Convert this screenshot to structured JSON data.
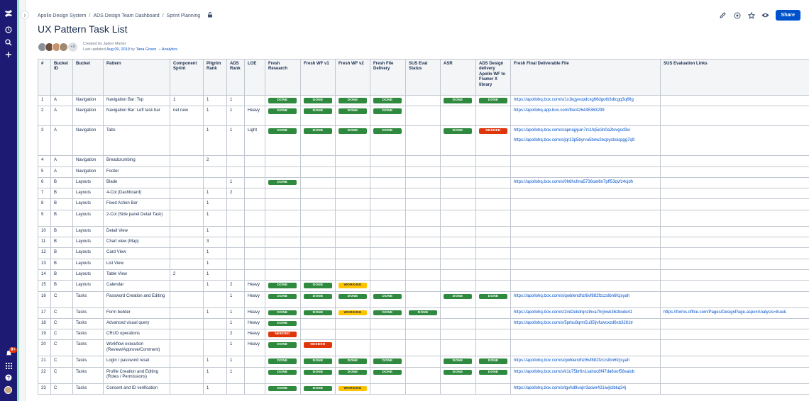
{
  "breadcrumbs": [
    "Apollo Design System",
    "ADS Design Team Dashboard",
    "Sprint Planning"
  ],
  "page_title": "UX Pattern Task List",
  "byline": {
    "created": "Created by Jaden Maher",
    "updated_prefix": "Last updated",
    "updated_date": "Aug 09, 2019",
    "by": "by",
    "author": "Tana Green",
    "analytics": "Analytics",
    "more_count": "+3"
  },
  "share_label": "Share",
  "columns": [
    "#",
    "Bucket ID",
    "Bucket",
    "Pattern",
    "Component Sprint",
    "Pilgrim Rank",
    "ADS Rank",
    "LOE",
    "Fresh Research",
    "Fresh WF v1",
    "Fresh WF v2",
    "Fresh File Delivery",
    "SUS Eval Status",
    "ASR",
    "ADS Design delivery Apollo WF to Framer X library",
    "Fresh Final Deliverable File",
    "SUS Evaluation Links"
  ],
  "rows": [
    {
      "n": "1",
      "bid": "A",
      "bucket": "Navigation",
      "pattern": "Navigation Bar: Top",
      "sprint": "1",
      "pilgrim": "1",
      "ads": "1",
      "loe": "",
      "research": "DONE",
      "wf1": "DONE",
      "wf2": "DONE",
      "file": "DONE",
      "sus": "",
      "asr": "DONE",
      "ads_delivery": "DONE",
      "links": [
        "https://apollohq.box.com/s/1x1kgyvupdcxg66dgotb3dtcgq3q6flg"
      ],
      "sus_links": ""
    },
    {
      "n": "2",
      "bid": "A",
      "bucket": "Navigation",
      "pattern": "Navigation Bar: Left task bar",
      "sprint": "net new",
      "pilgrim": "1",
      "ads": "1",
      "loe": "Heavy",
      "research": "DONE",
      "wf1": "DONE",
      "wf2": "DONE",
      "file": "DONE",
      "sus": "",
      "asr": "",
      "ads_delivery": "",
      "links": [
        "https://apollohq.app.box.com/file/426445363299"
      ],
      "sus_links": ""
    },
    {
      "n": "3",
      "bid": "A",
      "bucket": "Navigation",
      "pattern": "Tabs",
      "sprint": "",
      "pilgrim": "1",
      "ads": "1",
      "loe": "Light",
      "research": "DONE",
      "wf1": "DONE",
      "wf2": "DONE",
      "file": "DONE",
      "sus": "",
      "asr": "DONE",
      "ads_delivery": "NEEDED",
      "links": [
        "https://apollohq.box.com/s/apnajyjuin7rs1fq5e3n0a2tovgsd3vi",
        "https://apollohq.box.com/s/jqr13p5byrvu5bnw2ecpycbsispgg7q9"
      ],
      "sus_links": ""
    },
    {
      "n": "4",
      "bid": "A",
      "bucket": "Navigation",
      "pattern": "Breadcrumbing",
      "sprint": "",
      "pilgrim": "2",
      "ads": "",
      "loe": "",
      "research": "",
      "wf1": "",
      "wf2": "",
      "file": "",
      "sus": "",
      "asr": "",
      "ads_delivery": "",
      "links": [],
      "sus_links": ""
    },
    {
      "n": "5",
      "bid": "A",
      "bucket": "Navigation",
      "pattern": "Footer",
      "sprint": "",
      "pilgrim": "",
      "ads": "",
      "loe": "",
      "research": "",
      "wf1": "",
      "wf2": "",
      "file": "",
      "sus": "",
      "asr": "",
      "ads_delivery": "",
      "links": [],
      "sus_links": ""
    },
    {
      "n": "6",
      "bid": "B",
      "bucket": "Layouts",
      "pattern": "Blade",
      "sprint": "",
      "pilgrim": "",
      "ads": "1",
      "loe": "",
      "research": "DONE",
      "wf1": "",
      "wf2": "",
      "file": "",
      "sus": "",
      "asr": "",
      "ads_delivery": "",
      "links": [
        "https://apollohq.box.com/s/0h6hcfma5736oet6n7pff53qvfz4cjdh"
      ],
      "sus_links": ""
    },
    {
      "n": "7",
      "bid": "B",
      "bucket": "Layouts",
      "pattern": "4-Col (Dashboard)",
      "sprint": "",
      "pilgrim": "1",
      "ads": "2",
      "loe": "",
      "research": "",
      "wf1": "",
      "wf2": "",
      "file": "",
      "sus": "",
      "asr": "",
      "ads_delivery": "",
      "links": [],
      "sus_links": ""
    },
    {
      "n": "8",
      "bid": "B",
      "bucket": "Layouts",
      "pattern": "Fixed Action Bar",
      "sprint": "",
      "pilgrim": "1",
      "ads": "",
      "loe": "",
      "research": "",
      "wf1": "",
      "wf2": "",
      "file": "",
      "sus": "",
      "asr": "",
      "ads_delivery": "",
      "links": [],
      "sus_links": ""
    },
    {
      "n": "9",
      "bid": "B",
      "bucket": "Layouts",
      "pattern": "2-Col (Side panel Detail Task)",
      "sprint": "",
      "pilgrim": "1",
      "ads": "",
      "loe": "",
      "research": "",
      "wf1": "",
      "wf2": "",
      "file": "",
      "sus": "",
      "asr": "",
      "ads_delivery": "",
      "links": [],
      "sus_links": ""
    },
    {
      "n": "10",
      "bid": "B",
      "bucket": "Layouts",
      "pattern": "Detail View",
      "sprint": "",
      "pilgrim": "1",
      "ads": "",
      "loe": "",
      "research": "",
      "wf1": "",
      "wf2": "",
      "file": "",
      "sus": "",
      "asr": "",
      "ads_delivery": "",
      "links": [],
      "sus_links": ""
    },
    {
      "n": "11",
      "bid": "B",
      "bucket": "Layouts",
      "pattern": "Chart view (Map)",
      "sprint": "",
      "pilgrim": "3",
      "ads": "",
      "loe": "",
      "research": "",
      "wf1": "",
      "wf2": "",
      "file": "",
      "sus": "",
      "asr": "",
      "ads_delivery": "",
      "links": [],
      "sus_links": ""
    },
    {
      "n": "12",
      "bid": "B",
      "bucket": "Layouts",
      "pattern": "Card View",
      "sprint": "",
      "pilgrim": "1",
      "ads": "",
      "loe": "",
      "research": "",
      "wf1": "",
      "wf2": "",
      "file": "",
      "sus": "",
      "asr": "",
      "ads_delivery": "",
      "links": [],
      "sus_links": ""
    },
    {
      "n": "13",
      "bid": "B",
      "bucket": "Layouts",
      "pattern": "List View",
      "sprint": "",
      "pilgrim": "1",
      "ads": "",
      "loe": "",
      "research": "",
      "wf1": "",
      "wf2": "",
      "file": "",
      "sus": "",
      "asr": "",
      "ads_delivery": "",
      "links": [],
      "sus_links": ""
    },
    {
      "n": "14",
      "bid": "B",
      "bucket": "Layouts",
      "pattern": "Table View",
      "sprint": "2",
      "pilgrim": "1",
      "ads": "",
      "loe": "",
      "research": "",
      "wf1": "",
      "wf2": "",
      "file": "",
      "sus": "",
      "asr": "",
      "ads_delivery": "",
      "links": [],
      "sus_links": ""
    },
    {
      "n": "15",
      "bid": "B",
      "bucket": "Layouts",
      "pattern": "Calendar",
      "sprint": "",
      "pilgrim": "1",
      "ads": "2",
      "loe": "Heavy",
      "research": "DONE",
      "wf1": "DONE",
      "wf2": "WORKING",
      "file": "",
      "sus": "",
      "asr": "",
      "ads_delivery": "",
      "links": [],
      "sus_links": ""
    },
    {
      "n": "16",
      "bid": "C",
      "bucket": "Tasks",
      "pattern": "Password Creation and Editing",
      "sprint": "",
      "pilgrim": "",
      "ads": "1",
      "loe": "Heavy",
      "research": "DONE",
      "wf1": "DONE",
      "wf2": "DONE",
      "file": "DONE",
      "sus": "",
      "asr": "DONE",
      "ads_delivery": "DONE",
      "links": [
        "https://apollohq.box.com/s/qwblendhzl6vf882fzczslbn6fcjsyah"
      ],
      "sus_links": ""
    },
    {
      "n": "17",
      "bid": "C",
      "bucket": "Tasks",
      "pattern": "Form builder",
      "sprint": "",
      "pilgrim": "1",
      "ads": "1",
      "loe": "Heavy",
      "research": "DONE",
      "wf1": "DONE",
      "wf2": "WORKING",
      "file": "DONE",
      "sus": "DONE",
      "asr": "",
      "ads_delivery": "",
      "links": [
        "https://apollohq.box.com/s/zird2ekdrqnzihva7hrjnwk36zbode41"
      ],
      "sus_links": "https://forms.office.com/Pages/DesignPage.aspx#Analysis=true&"
    },
    {
      "n": "18",
      "bid": "C",
      "bucket": "Tasks",
      "pattern": "Advanced visual query",
      "sprint": "",
      "pilgrim": "",
      "ads": "1",
      "loe": "Heavy",
      "research": "DONE",
      "wf1": "",
      "wf2": "",
      "file": "",
      "sus": "",
      "asr": "",
      "ads_delivery": "",
      "links": [
        "https://apollohq.box.com/s/5prbu8qrm5u35ljvfuwoxzd6xb3261tr"
      ],
      "sus_links": ""
    },
    {
      "n": "19",
      "bid": "C",
      "bucket": "Tasks",
      "pattern": "CRUD operations",
      "sprint": "",
      "pilgrim": "",
      "ads": "2",
      "loe": "Heavy",
      "research": "NEEDED",
      "wf1": "",
      "wf2": "",
      "file": "",
      "sus": "",
      "asr": "",
      "ads_delivery": "",
      "links": [],
      "sus_links": ""
    },
    {
      "n": "20",
      "bid": "C",
      "bucket": "Tasks",
      "pattern": "Workflow execution (Review/Approve/Comment)",
      "sprint": "",
      "pilgrim": "",
      "ads": "1",
      "loe": "Heavy",
      "research": "DONE",
      "wf1": "NEEDED",
      "wf2": "",
      "file": "",
      "sus": "",
      "asr": "",
      "ads_delivery": "",
      "links": [],
      "sus_links": ""
    },
    {
      "n": "21",
      "bid": "C",
      "bucket": "Tasks",
      "pattern": "Login / password reset",
      "sprint": "",
      "pilgrim": "1",
      "ads": "1",
      "loe": "",
      "research": "DONE",
      "wf1": "DONE",
      "wf2": "DONE",
      "file": "DONE",
      "sus": "",
      "asr": "DONE",
      "ads_delivery": "DONE",
      "links": [
        "https://apollohq.box.com/s/qwblendhzl6vf882fzczslbn6fcjsyah"
      ],
      "sus_links": ""
    },
    {
      "n": "22",
      "bid": "C",
      "bucket": "Tasks",
      "pattern": "Profile Creation and Editing (Roles / Permissions)",
      "sprint": "",
      "pilgrim": "1",
      "ads": "1",
      "loe": "",
      "research": "DONE",
      "wf1": "DONE",
      "wf2": "DONE",
      "file": "DONE",
      "sus": "",
      "asr": "DONE",
      "ads_delivery": "DONE",
      "links": [
        "https://apollohq.box.com/s/k1u75br6n1sahuc8f47da6oof58saiob"
      ],
      "sus_links": ""
    },
    {
      "n": "23",
      "bid": "C",
      "bucket": "Tasks",
      "pattern": "Consent and ID verification",
      "sprint": "",
      "pilgrim": "1",
      "ads": "",
      "loe": "",
      "research": "DONE",
      "wf1": "DONE",
      "wf2": "WORKING",
      "file": "",
      "sus": "",
      "asr": "",
      "ads_delivery": "",
      "links": [
        "https://apollohq.box.com/s/tgvhd9uojrr3aowr421iwjlclbkq34j"
      ],
      "sus_links": ""
    }
  ],
  "colors": {
    "done": "#2f8a3f",
    "working": "#ffc400",
    "needed": "#de350b",
    "rail": "#1c1a73",
    "link": "#0052cc"
  },
  "icons": {
    "rail": [
      "confluence-logo-icon",
      "recent-icon",
      "search-icon",
      "create-icon"
    ],
    "rail_bottom": [
      "notifications-icon",
      "app-switcher-icon",
      "help-icon",
      "profile-avatar"
    ],
    "actions": [
      "edit-icon",
      "watch-icon",
      "star-icon",
      "view-icon"
    ]
  }
}
